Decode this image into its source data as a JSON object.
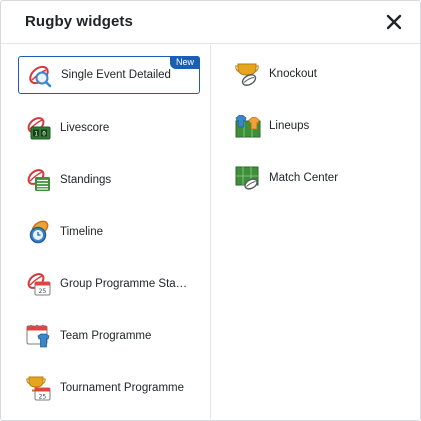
{
  "dialog": {
    "title": "Rugby widgets",
    "close_icon": "close-icon"
  },
  "left_items": [
    {
      "label": "Single Event Detailed",
      "icon": "rugby-ball-search-icon",
      "badge": "New",
      "selected": true
    },
    {
      "label": "Livescore",
      "icon": "rugby-ball-scoreboard-icon"
    },
    {
      "label": "Standings",
      "icon": "rugby-ball-table-icon"
    },
    {
      "label": "Timeline",
      "icon": "rugby-ball-clock-icon"
    },
    {
      "label": "Group Programme Sta…",
      "icon": "rugby-ball-calendar-icon"
    },
    {
      "label": "Team Programme",
      "icon": "calendar-jersey-icon"
    },
    {
      "label": "Tournament Programme",
      "icon": "trophy-calendar-icon"
    }
  ],
  "right_items": [
    {
      "label": "Knockout",
      "icon": "trophy-ball-icon"
    },
    {
      "label": "Lineups",
      "icon": "jerseys-pitch-icon"
    },
    {
      "label": "Match Center",
      "icon": "pitch-ball-icon"
    }
  ],
  "colors": {
    "accent": "#1a5fb4",
    "ball_red": "#d6383a",
    "green": "#3f8f3a",
    "calendar_red": "#e0443c",
    "trophy_gold": "#e6a51e",
    "jersey_blue": "#3a86c8"
  }
}
